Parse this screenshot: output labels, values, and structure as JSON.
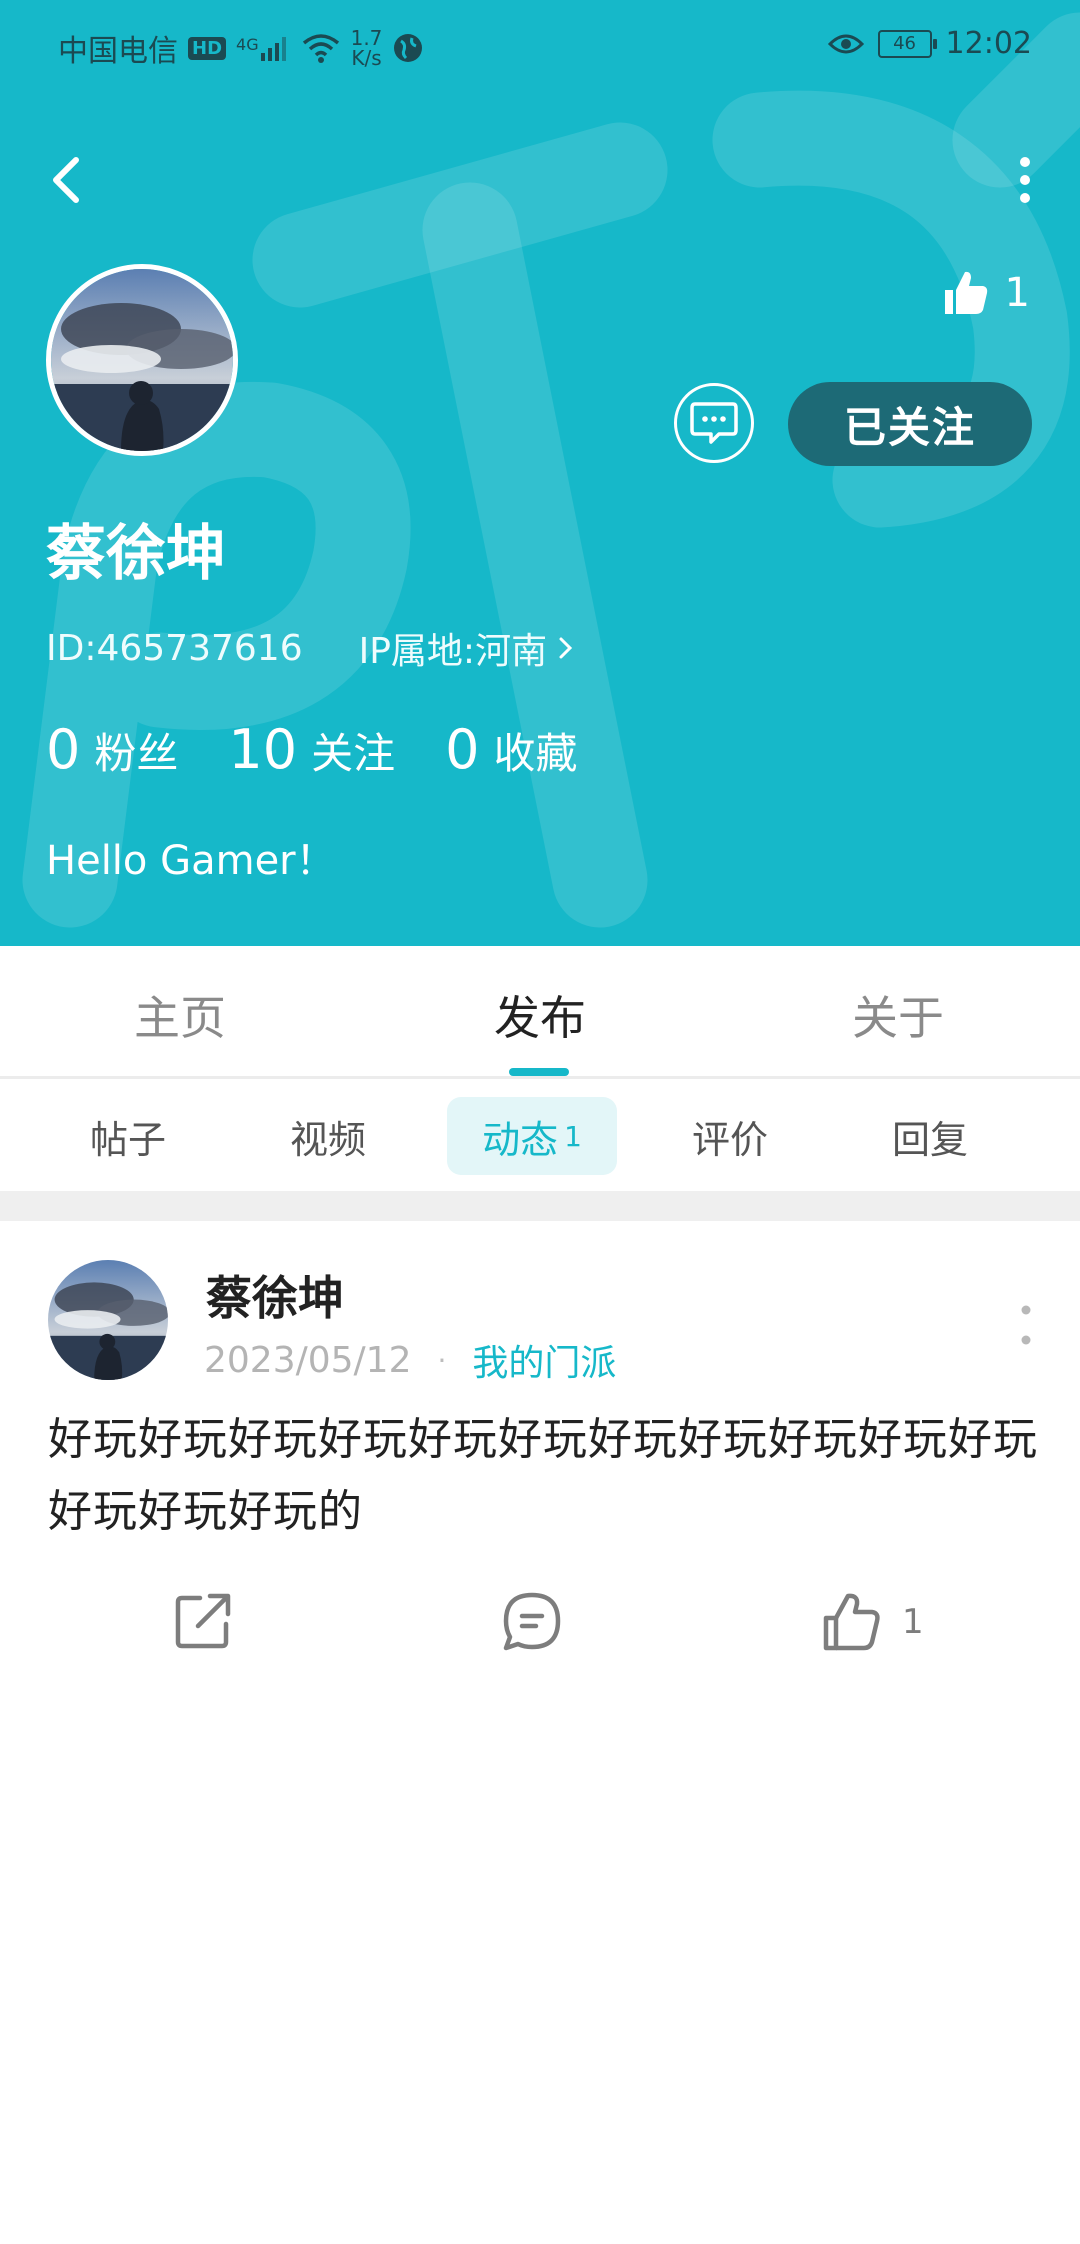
{
  "status_bar": {
    "carrier": "中国电信",
    "hd": "HD",
    "network": "4G",
    "speed_value": "1.7",
    "speed_unit": "K/s",
    "battery": "46",
    "time": "12:02"
  },
  "profile": {
    "likes": "1",
    "follow_label": "已关注",
    "name": "蔡徐坤",
    "id_text": "ID:465737616",
    "ip_text": "IP属地:河南",
    "stats": [
      {
        "num": "0",
        "label": "粉丝"
      },
      {
        "num": "10",
        "label": "关注"
      },
      {
        "num": "0",
        "label": "收藏"
      }
    ],
    "bio": "Hello Gamer！"
  },
  "tabs": [
    {
      "label": "主页"
    },
    {
      "label": "发布"
    },
    {
      "label": "关于"
    }
  ],
  "subtabs": [
    {
      "label": "帖子"
    },
    {
      "label": "视频"
    },
    {
      "label": "动态",
      "count": "1"
    },
    {
      "label": "评价"
    },
    {
      "label": "回复"
    }
  ],
  "post": {
    "author": "蔡徐坤",
    "date": "2023/05/12",
    "dot": "·",
    "section": "我的门派",
    "content": "好玩好玩好玩好玩好玩好玩好玩好玩好玩好玩好玩好玩好玩好玩的",
    "like_count": "1"
  },
  "colors": {
    "accent": "#16b8c9",
    "follow_button": "#1d6a76"
  }
}
